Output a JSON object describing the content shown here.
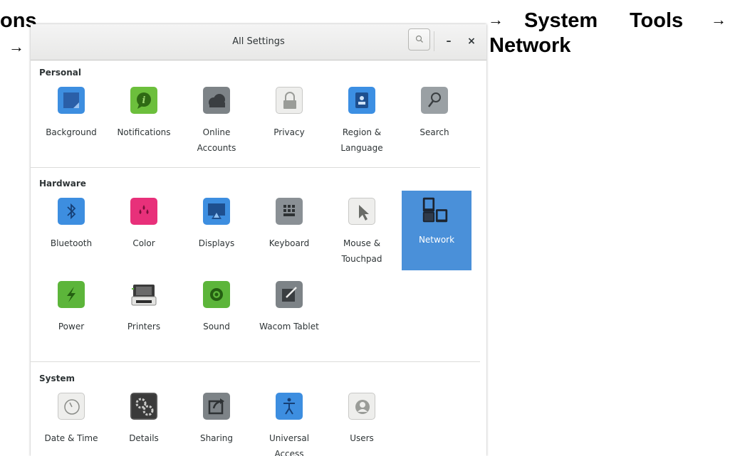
{
  "document": {
    "left_fragment": "ons",
    "left_arrow": "→",
    "right_arrow_1": "→",
    "right_text_1": "System",
    "right_text_2": "Tools",
    "right_arrow_2": "→",
    "right_text_3": "Network"
  },
  "window": {
    "title": "All Settings",
    "search_icon": "search-icon",
    "minimize_label": "–",
    "close_label": "×"
  },
  "sections": {
    "personal": {
      "title": "Personal",
      "items": [
        {
          "label": "Background",
          "icon": "background-icon",
          "color": "#3d8ee0"
        },
        {
          "label": "Notifications",
          "icon": "notifications-icon",
          "color": "#6cbf3c"
        },
        {
          "label": "Online\nAccounts",
          "icon": "online-accounts-icon",
          "color": "#7d8387"
        },
        {
          "label": "Privacy",
          "icon": "lock-icon",
          "color": "#eeeeec"
        },
        {
          "label": "Region &\nLanguage",
          "icon": "region-icon",
          "color": "#3c8fe3"
        },
        {
          "label": "Search",
          "icon": "search-icon",
          "color": "#9aa0a4"
        }
      ]
    },
    "hardware": {
      "title": "Hardware",
      "items": [
        {
          "label": "Bluetooth",
          "icon": "bluetooth-icon",
          "color": "#3d8ee0"
        },
        {
          "label": "Color",
          "icon": "color-icon",
          "color": "#e8307a"
        },
        {
          "label": "Displays",
          "icon": "displays-icon",
          "color": "#3d8ee0"
        },
        {
          "label": "Keyboard",
          "icon": "keyboard-icon",
          "color": "#8a9095"
        },
        {
          "label": "Mouse &\nTouchpad",
          "icon": "mouse-pointer-icon",
          "color": "#eeeeec"
        },
        {
          "label": "Network",
          "icon": "network-icon",
          "color": "#2f3a4a"
        },
        {
          "label": "Power",
          "icon": "power-icon",
          "color": "#5cb53a"
        },
        {
          "label": "Printers",
          "icon": "printer-icon",
          "color": "#4a4a4a"
        },
        {
          "label": "Sound",
          "icon": "sound-icon",
          "color": "#5cb53a"
        },
        {
          "label": "Wacom Tablet",
          "icon": "tablet-icon",
          "color": "#7d8387"
        }
      ]
    },
    "system": {
      "title": "System",
      "items": [
        {
          "label": "Date & Time",
          "icon": "clock-icon",
          "color": "#eeeeec"
        },
        {
          "label": "Details",
          "icon": "gears-icon",
          "color": "#555555"
        },
        {
          "label": "Sharing",
          "icon": "sharing-icon",
          "color": "#7d8387"
        },
        {
          "label": "Universal\nAccess",
          "icon": "accessibility-icon",
          "color": "#3d8ee0"
        },
        {
          "label": "Users",
          "icon": "user-icon",
          "color": "#eeeeec"
        }
      ]
    }
  },
  "selected_item": "Network"
}
